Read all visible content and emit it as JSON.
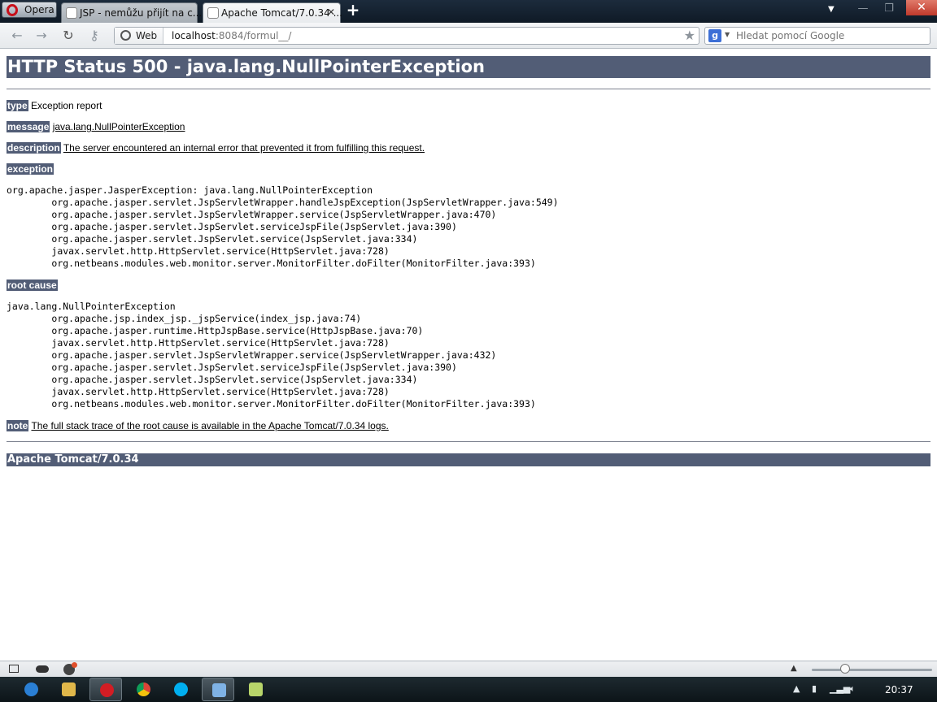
{
  "browser": {
    "menu_button": "Opera",
    "tabs": [
      {
        "label": "JSP - nemůžu přijít na c...",
        "active": false
      },
      {
        "label": "Apache Tomcat/7.0.34 ...",
        "active": true
      }
    ],
    "new_tab": "+",
    "address": {
      "badge": "Web",
      "host": "localhost",
      "rest": ":8084/formul__/"
    },
    "search": {
      "engine_icon": "g",
      "placeholder": "Hledat pomocí Google"
    }
  },
  "page": {
    "title": "HTTP Status 500 - java.lang.NullPointerException",
    "type_label": "type",
    "type_value": "Exception report",
    "message_label": "message",
    "message_value": "java.lang.NullPointerException",
    "description_label": "description",
    "description_value": "The server encountered an internal error that prevented it from fulfilling this request.",
    "exception_label": "exception",
    "exception_trace": "org.apache.jasper.JasperException: java.lang.NullPointerException\n\torg.apache.jasper.servlet.JspServletWrapper.handleJspException(JspServletWrapper.java:549)\n\torg.apache.jasper.servlet.JspServletWrapper.service(JspServletWrapper.java:470)\n\torg.apache.jasper.servlet.JspServlet.serviceJspFile(JspServlet.java:390)\n\torg.apache.jasper.servlet.JspServlet.service(JspServlet.java:334)\n\tjavax.servlet.http.HttpServlet.service(HttpServlet.java:728)\n\torg.netbeans.modules.web.monitor.server.MonitorFilter.doFilter(MonitorFilter.java:393)",
    "root_cause_label": "root cause",
    "root_cause_trace": "java.lang.NullPointerException\n\torg.apache.jsp.index_jsp._jspService(index_jsp.java:74)\n\torg.apache.jasper.runtime.HttpJspBase.service(HttpJspBase.java:70)\n\tjavax.servlet.http.HttpServlet.service(HttpServlet.java:728)\n\torg.apache.jasper.servlet.JspServletWrapper.service(JspServletWrapper.java:432)\n\torg.apache.jasper.servlet.JspServlet.serviceJspFile(JspServlet.java:390)\n\torg.apache.jasper.servlet.JspServlet.service(JspServlet.java:334)\n\tjavax.servlet.http.HttpServlet.service(HttpServlet.java:728)\n\torg.netbeans.modules.web.monitor.server.MonitorFilter.doFilter(MonitorFilter.java:393)",
    "note_label": "note",
    "note_value": "The full stack trace of the root cause is available in the Apache Tomcat/7.0.34 logs.",
    "footer": "Apache Tomcat/7.0.34"
  },
  "taskbar": {
    "clock": "20:37"
  },
  "colors": {
    "tomcat_header": "#525d76",
    "tab_bar": "#1c2b3c"
  }
}
